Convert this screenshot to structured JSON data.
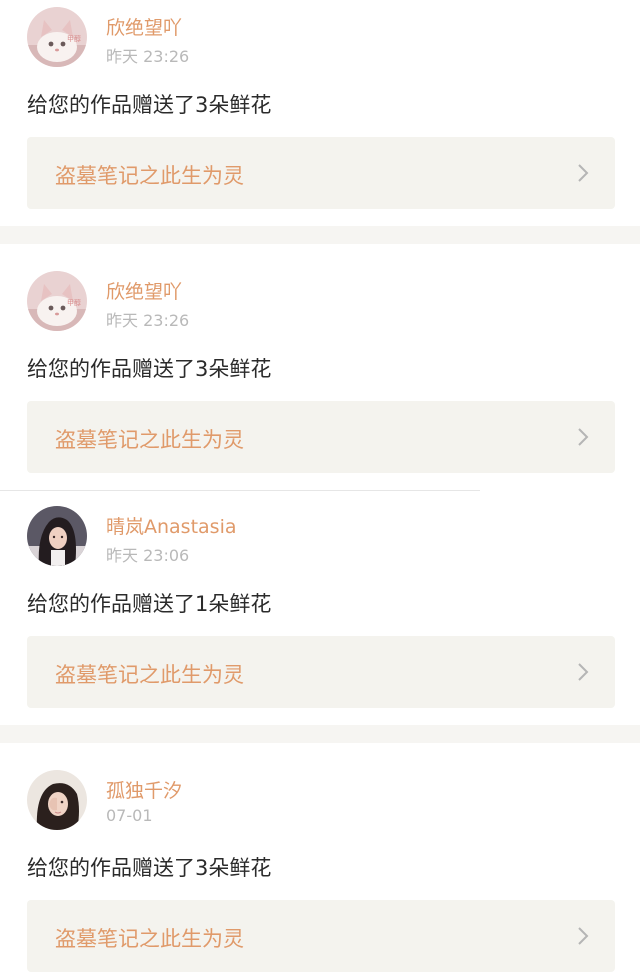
{
  "notifications": [
    {
      "avatar_icon": "kitten-photo-avatar",
      "username": "欣绝望吖",
      "time": "昨天 23:26",
      "message": "给您的作品赠送了3朵鲜花",
      "work_title": "盗墓笔记之此生为灵"
    },
    {
      "avatar_icon": "kitten-photo-avatar",
      "username": "欣绝望吖",
      "time": "昨天 23:26",
      "message": "给您的作品赠送了3朵鲜花",
      "work_title": "盗墓笔记之此生为灵"
    },
    {
      "avatar_icon": "girl-portrait-avatar",
      "username": "晴岚Anastasia",
      "time": "昨天 23:06",
      "message": "给您的作品赠送了1朵鲜花",
      "work_title": "盗墓笔记之此生为灵"
    },
    {
      "avatar_icon": "girl-portrait-avatar",
      "username": "孤独千汐",
      "time": "07-01",
      "message": "给您的作品赠送了3朵鲜花",
      "work_title": "盗墓笔记之此生为灵"
    }
  ],
  "colors": {
    "username": "#e09a6a",
    "link_title": "#e09a6a",
    "link_background": "#f4f3ee",
    "separator": "#f6f5f2",
    "time": "#b9b9b9",
    "message": "#2b2b2b"
  }
}
